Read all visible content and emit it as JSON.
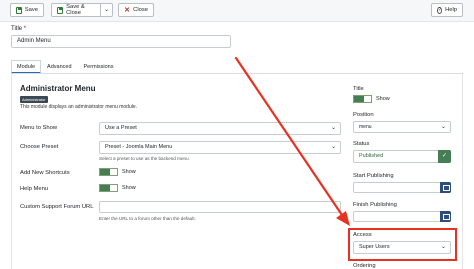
{
  "toolbar": {
    "save_label": "Save",
    "save_close_label": "Save & Close",
    "close_label": "Close",
    "help_label": "Help"
  },
  "title_field": {
    "label": "Title",
    "required_mark": "*",
    "value": "Admin Menu"
  },
  "tabs": [
    {
      "label": "Module",
      "active": true
    },
    {
      "label": "Advanced",
      "active": false
    },
    {
      "label": "Permissions",
      "active": false
    }
  ],
  "module": {
    "heading": "Administrator Menu",
    "badge": "Administrator",
    "description": "This module displays an administrator menu module."
  },
  "fields": {
    "menu_to_show": {
      "label": "Menu to Show",
      "value": "Use a Preset"
    },
    "choose_preset": {
      "label": "Choose Preset",
      "value": "Preset - Joomla Main Menu",
      "hint": "Select a preset to use as the backend menu"
    },
    "add_shortcuts": {
      "label": "Add New Shortcuts",
      "value": "Show"
    },
    "help_menu": {
      "label": "Help Menu",
      "value": "Show"
    },
    "forum_url": {
      "label": "Custom Support Forum URL",
      "value": "",
      "hint": "Enter the URL to a forum other than the default."
    }
  },
  "sidebar": {
    "title_label": "Title",
    "title_value": "Show",
    "position_label": "Position",
    "position_value": "menu",
    "status_label": "Status",
    "status_value": "Published",
    "start_label": "Start Publishing",
    "finish_label": "Finish Publishing",
    "access_label": "Access",
    "access_value": "Super Users",
    "ordering_label": "Ordering"
  },
  "colors": {
    "accent": "#2a69b8",
    "toggle_on": "#457d54",
    "annotation": "#e53223",
    "calendar_button": "#2d4e7c"
  }
}
